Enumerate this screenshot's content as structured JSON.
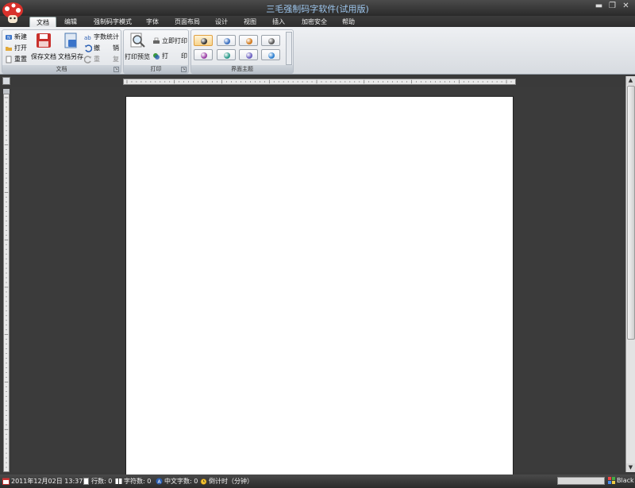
{
  "window": {
    "title": "三毛强制码字软件(试用版)",
    "controls": [
      "minimize",
      "restore",
      "close"
    ]
  },
  "tabs": [
    {
      "label": "文档",
      "active": true
    },
    {
      "label": "编辑",
      "active": false
    },
    {
      "label": "强制码字模式",
      "active": false
    },
    {
      "label": "字体",
      "active": false
    },
    {
      "label": "页面布局",
      "active": false
    },
    {
      "label": "设计",
      "active": false
    },
    {
      "label": "视图",
      "active": false
    },
    {
      "label": "插入",
      "active": false
    },
    {
      "label": "加密安全",
      "active": false
    },
    {
      "label": "帮助",
      "active": false
    }
  ],
  "ribbon": {
    "doc_group": {
      "label": "文档",
      "new": "新建",
      "open": "打开",
      "reset": "重置",
      "save": "保存文档",
      "save_as": "文档另存",
      "word_count": "字数统计",
      "undo": "撤",
      "undo2": "销",
      "redo": "重",
      "redo2": "复"
    },
    "print_group": {
      "label": "打印",
      "preview": "打印预览",
      "print_now": "立即打印",
      "print": "打",
      "print2": "印"
    },
    "theme_group": {
      "label": "界面主题",
      "swatches": [
        {
          "color": "#333333",
          "selected": true
        },
        {
          "color": "#3a6fc0",
          "selected": false
        },
        {
          "color": "#d0781a",
          "selected": false
        },
        {
          "color": "#555555",
          "selected": false
        },
        {
          "color": "#9b3fa6",
          "selected": false
        },
        {
          "color": "#2a9a8a",
          "selected": false
        },
        {
          "color": "#6b5fc0",
          "selected": false
        },
        {
          "color": "#2d7fd0",
          "selected": false
        }
      ]
    }
  },
  "statusbar": {
    "date": "2011年12月02日 13:37",
    "lines": "行数: 0",
    "chars": "字符数: 0",
    "cn_chars": "中文字数: 0",
    "timer": "倒计时（分钟）",
    "theme": "Black"
  },
  "colors": {
    "titlebar": "#2a2a2a",
    "title_text": "#9ec7ef",
    "ribbon": "#e1e4e8",
    "workspace": "#3b3b3b",
    "page": "#ffffff"
  }
}
